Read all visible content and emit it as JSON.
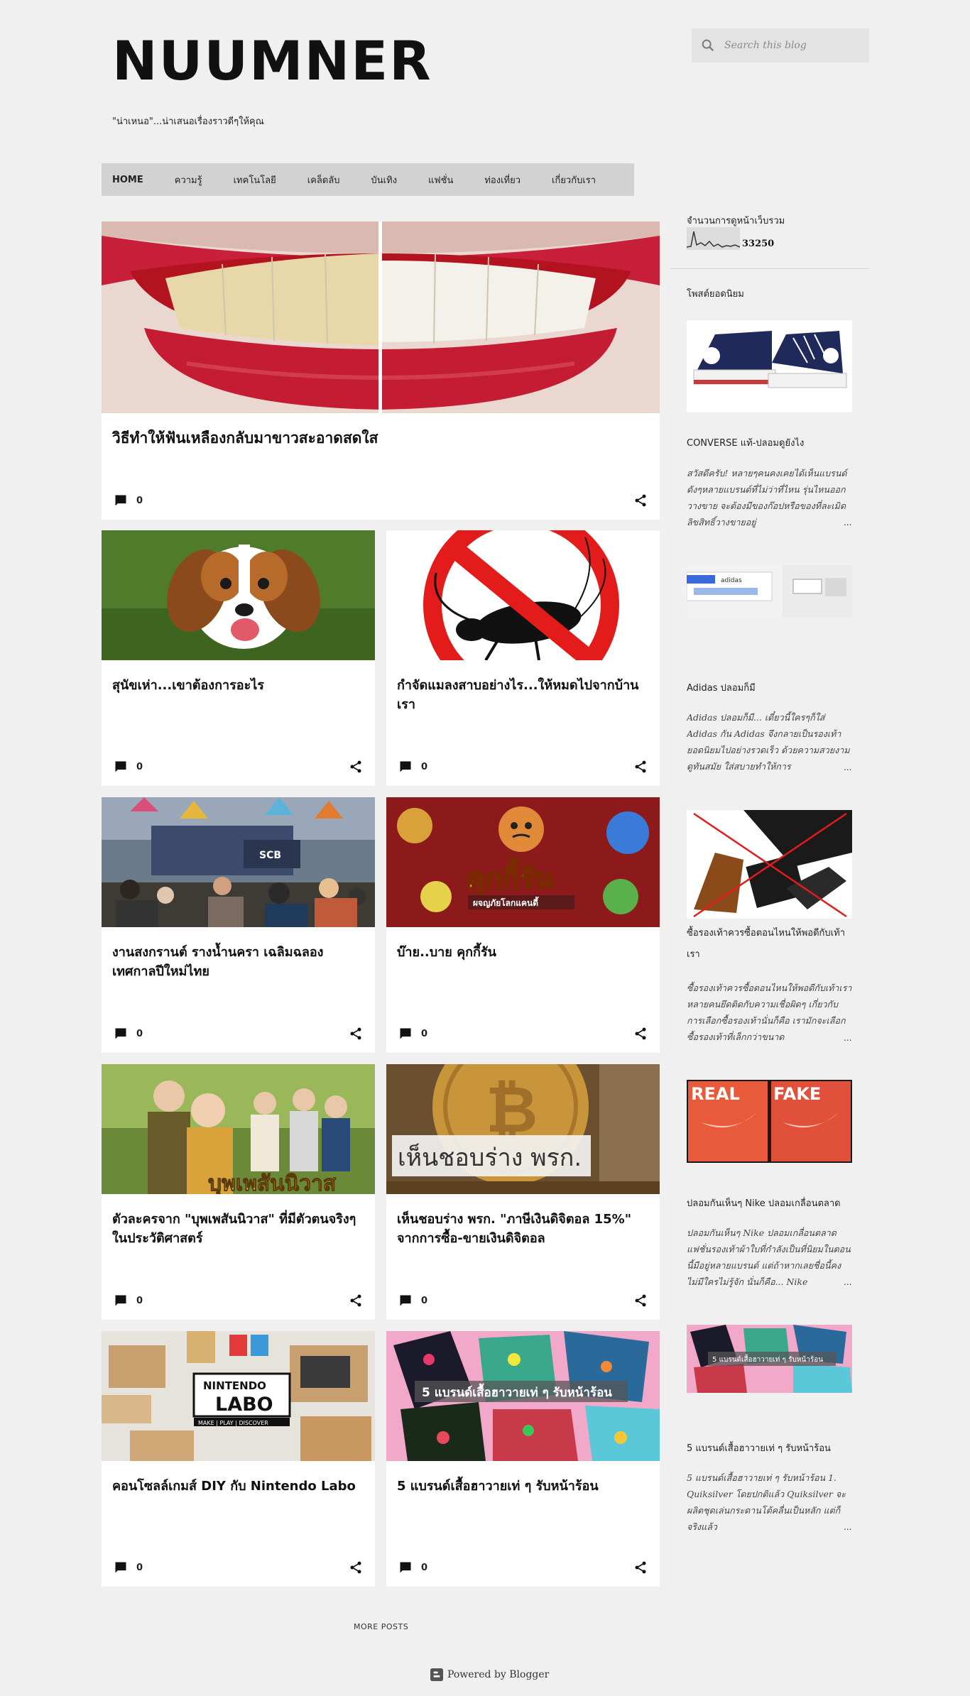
{
  "header": {
    "title": "NUUMNER",
    "description": "\"น่าเหนอ\"...น่าเสนอเรื่องราวดีๆให้คุณ"
  },
  "search": {
    "placeholder": "Search this blog",
    "icon": "search-icon"
  },
  "nav": {
    "items": [
      {
        "label": "HOME",
        "active": true
      },
      {
        "label": "ความรู้"
      },
      {
        "label": "เทคโนโลยี"
      },
      {
        "label": "เคล็ดลับ"
      },
      {
        "label": "บันเทิง"
      },
      {
        "label": "แฟชั่น"
      },
      {
        "label": "ท่องเที่ยว"
      },
      {
        "label": "เกี่ยวกับเรา"
      }
    ]
  },
  "posts": [
    {
      "title": "วิธีทำให้ฟันเหลืองกลับมาขาวสะอาดสดใส",
      "comments": "0"
    },
    {
      "title": "สุนัขเห่า...เขาต้องการอะไร",
      "comments": "0"
    },
    {
      "title": "กำจัดแมลงสาบอย่างไร...ให้หมดไปจากบ้านเรา",
      "comments": "0"
    },
    {
      "title": "งานสงกรานต์ รางน้ำนครา เฉลิมฉลองเทศกาลปีใหม่ไทย",
      "comments": "0",
      "image_text": "SCB"
    },
    {
      "title": "บ๊าย..บาย คุกกี้รัน",
      "comments": "0",
      "image_text": "คุกกี้รัน",
      "image_subtext": "ผจญภัยโลกแคนดี้"
    },
    {
      "title": "ตัวละครจาก \"บุพเพสันนิวาส\" ที่มีตัวตนจริงๆในประวัติศาสตร์",
      "comments": "0",
      "image_text": "บุพเพสันนิวาส"
    },
    {
      "title": "เห็นชอบร่าง พรก. \"ภาษีเงินดิจิตอล 15%\" จากการซื้อ-ขายเงินดิจิตอล",
      "comments": "0",
      "image_text": "เห็นชอบร่าง พรก."
    },
    {
      "title": "คอนโซลล์เกมส์ DIY กับ Nintendo Labo",
      "comments": "0",
      "image_text": "NINTENDO",
      "image_text2": "LABO",
      "image_text3": "MAKE | PLAY | DISCOVER"
    },
    {
      "title": "5 แบรนด์เสื้อฮาวายเท่ ๆ รับหน้าร้อน",
      "comments": "0",
      "image_text": "5 แบรนด์เสื้อฮาวายเท่ ๆ รับหน้าร้อน"
    }
  ],
  "more_posts": "MORE POSTS",
  "footer": {
    "powered_by": "Powered by Blogger"
  },
  "sidebar": {
    "stats_title": "จำนวนการดูหน้าเว็บรวม",
    "stats_count": "33250",
    "popular_title": "โพสต์ยอดนิยม",
    "popular": [
      {
        "title": "CONVERSE แท้-ปลอมดูยังไง",
        "snippet": "สวัสดีครับ! หลายๆคนคงเคยได้เห็นแบรนด์ดังๆหลายแบรนด์ที่ไม่ว่าที่ไหน รุ่นไหนออกวางขาย จะต้องมีของก๊อปหรือของที่ละเมิดลิขสิทธิ์วางขายอยู่"
      },
      {
        "title": "Adidas ปลอมก็มี",
        "snippet": "Adidas ปลอมก็มี... เดี๋ยวนี้ใครๆก็ใส่ Adidas กัน Adidas จึงกลายเป็นรองเท้ายอดนิยมไปอย่างรวดเร็ว ด้วยความสวยงาม ดูทันสมัย ใส่สบายทำให้การ"
      },
      {
        "title": "ซื้อรองเท้าควรซื้อตอนไหนให้พอดีกับเท้าเรา",
        "snippet": "ซื้อรองเท้าควรซื้อตอนไหนให้พอดีกับเท้าเรา หลายคนยึดติดกับความเชื่อผิดๆ เกี่ยวกับการเลือกซื้อรองเท้านั่นก็คือ เรามักจะเลือกซื้อรองเท้าที่เล็กกว่าขนาด"
      },
      {
        "title": "ปลอมกันเห็นๆ Nike ปลอมเกลื่อนตลาด",
        "snippet": "ปลอมกันเห็นๆ Nike ปลอมเกลื่อนตลาด แฟชั่นรองเท้าผ้าใบที่กำลังเป็นที่นิยมในตอนนี้มีอยู่หลายแบรนด์ แต่ถ้าหากเลยชื่อนี้คงไม่มีใครไม่รู้จัก นั่นก็คือ... Nike"
      },
      {
        "title": "5 แบรนด์เสื้อฮาวายเท่ ๆ รับหน้าร้อน",
        "snippet": "5 แบรนด์เสื้อฮาวายเท่ ๆ รับหน้าร้อน 1. Quiksilver โดยปกติแล้ว Quiksilver จะผลิตชุดเล่นกระดานโต้คลื่นเป็นหลัก แต่ก็จริงแล้ว"
      }
    ],
    "pp_images": {
      "real": "REAL",
      "fake": "FAKE",
      "adidas": "adidas",
      "banner": "5 แบรนด์เสื้อฮาวายเท่ ๆ รับหน้าร้อน"
    },
    "more_marker": "..."
  }
}
